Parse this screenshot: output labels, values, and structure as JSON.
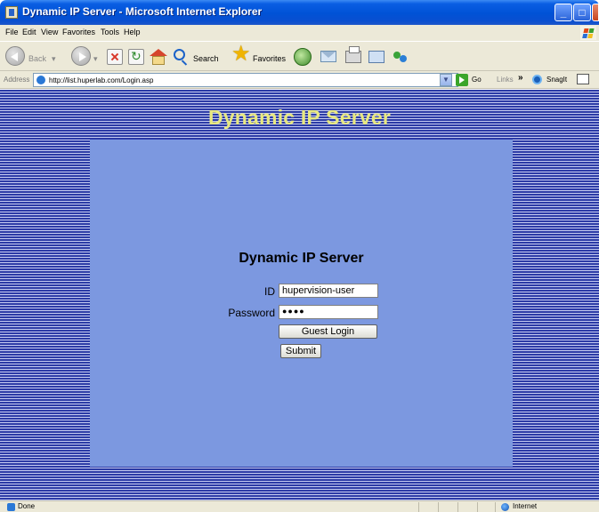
{
  "window": {
    "title": "Dynamic IP Server - Microsoft Internet Explorer"
  },
  "menu": [
    "File",
    "Edit",
    "View",
    "Favorites",
    "Tools",
    "Help"
  ],
  "toolbar": {
    "back_label": "Back",
    "search_label": "Search",
    "favorites_label": "Favorites"
  },
  "address": {
    "label": "Address",
    "url": "http://list.huperlab.com/Login.asp",
    "go_label": "Go",
    "links_label": "Links",
    "snagit_label": "SnagIt"
  },
  "page": {
    "header_title": "Dynamic IP Server",
    "form_title": "Dynamic IP Server",
    "id_label": "ID",
    "id_value": "hupervision-user",
    "password_label": "Password",
    "password_value": "●●●●",
    "guest_login_label": "Guest Login",
    "submit_label": "Submit"
  },
  "status": {
    "text": "Done",
    "zone": "Internet"
  }
}
